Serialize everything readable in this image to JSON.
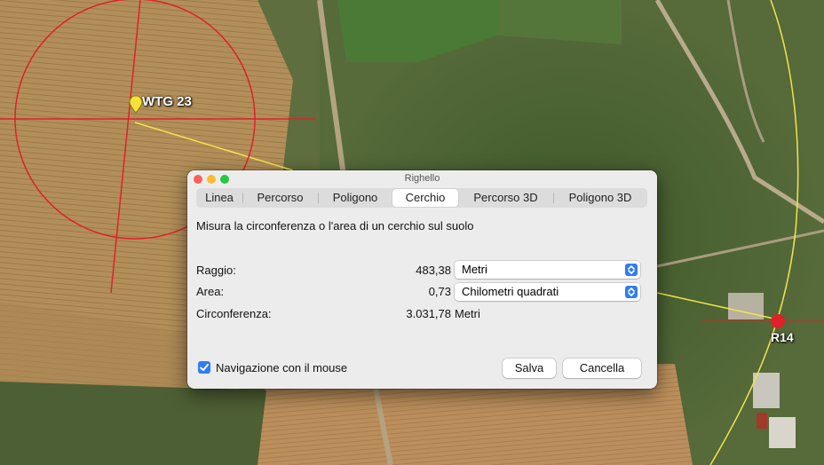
{
  "window": {
    "title": "Righello",
    "tabs": [
      "Linea",
      "Percorso",
      "Poligono",
      "Cerchio",
      "Percorso 3D",
      "Poligono 3D"
    ],
    "active_tab": "Cerchio",
    "description": "Misura la circonferenza o l'area di un cerchio sul suolo",
    "radius": {
      "label": "Raggio:",
      "value": "483,38",
      "unit": "Metri"
    },
    "area": {
      "label": "Area:",
      "value": "0,73",
      "unit": "Chilometri quadrati"
    },
    "circumference": {
      "label": "Circonferenza:",
      "value": "3.031,78",
      "unit": "Metri"
    },
    "mouse_navigation": {
      "label": "Navigazione con il mouse",
      "checked": true
    },
    "save_label": "Salva",
    "cancel_label": "Cancella"
  },
  "map": {
    "placemark_label": "WTG 23",
    "road_label": "R14"
  },
  "colors": {
    "accent": "#2f7cf6",
    "measure_circle": "#e0202a",
    "path_line": "#f2e64a",
    "placemark": "#f5e236"
  }
}
